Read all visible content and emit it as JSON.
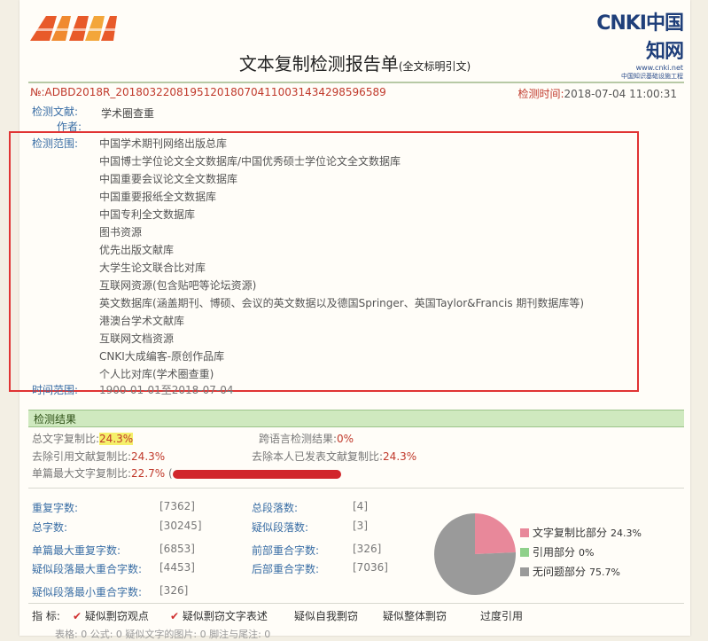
{
  "report": {
    "title": "文本复制检测报告单",
    "title_note": "(全文标明引文)",
    "id_label": "№:",
    "id_value": "ADBD2018R_2018032208195120180704110031434298596589",
    "time_label": "检测时间:",
    "time_value": "2018-07-04 11:00:31"
  },
  "logo_right": {
    "mark": "CNKI中国知网",
    "url": "www.cnki.net",
    "sub": "中国知识基础设施工程"
  },
  "meta": {
    "doc_label": "检测文献:",
    "doc_value": "学术圈查重",
    "author_label": "作者:",
    "author_value": "",
    "scope_label": "检测范围:",
    "time_range_label": "时间范围:",
    "time_range_value": "1900-01-01至2018-07-04"
  },
  "scope_items": [
    "中国学术期刊网络出版总库",
    "中国博士学位论文全文数据库/中国优秀硕士学位论文全文数据库",
    "中国重要会议论文全文数据库",
    "中国重要报纸全文数据库",
    "中国专利全文数据库",
    "图书资源",
    "优先出版文献库",
    "大学生论文联合比对库",
    "互联网资源(包含贴吧等论坛资源)",
    "英文数据库(涵盖期刊、博硕、会议的英文数据以及德国Springer、英国Taylor&Francis 期刊数据库等)",
    "港澳台学术文献库",
    "互联网文档资源",
    "CNKI大成编客-原创作品库",
    "个人比对库(学术圈查重)"
  ],
  "results": {
    "header": "检测结果",
    "total_label": "总文字复制比:",
    "total_value": "24.3%",
    "cross_lang_label": "跨语言检测结果:",
    "cross_lang_value": "0%",
    "excl_quote_label": "去除引用文献复制比:",
    "excl_quote_value": "24.3%",
    "excl_self_label": "去除本人已发表文献复制比:",
    "excl_self_value": "24.3%",
    "max_single_label": "单篇最大文字复制比:",
    "max_single_value": "22.7%",
    "max_single_paren": "("
  },
  "stats": {
    "dup_chars_label": "重复字数:",
    "dup_chars_value": "[7362]",
    "total_para_label": "总段落数:",
    "total_para_value": "[4]",
    "total_chars_label": "总字数:",
    "total_chars_value": "[30245]",
    "susp_para_label": "疑似段落数:",
    "susp_para_value": "[3]",
    "max_dup_label": "单篇最大重复字数:",
    "max_dup_value": "[6853]",
    "front_label": "前部重合字数:",
    "front_value": "[326]",
    "para_max_label": "疑似段落最大重合字数:",
    "para_max_value": "[4453]",
    "back_label": "后部重合字数:",
    "back_value": "[7036]",
    "para_min_label": "疑似段落最小重合字数:",
    "para_min_value": "[326]"
  },
  "chart_data": {
    "type": "pie",
    "categories": [
      "文字复制比部分",
      "引用部分",
      "无问题部分"
    ],
    "values": [
      24.3,
      0,
      75.7
    ],
    "colors": [
      "#e8889a",
      "#8fd08a",
      "#9a9a9a"
    ],
    "labels": [
      "24.3%",
      "0%",
      "75.7%"
    ]
  },
  "indicators": {
    "label": "指  标:",
    "items": [
      "疑似剽窃观点",
      "疑似剽窃文字表述",
      "疑似自我剽窃",
      "疑似整体剽窃",
      "过度引用"
    ],
    "checked": [
      true,
      true,
      false,
      false,
      false
    ]
  },
  "footer_partial": "表格: 0    公式: 0    疑似文字的图片: 0    脚注与尾注: 0"
}
